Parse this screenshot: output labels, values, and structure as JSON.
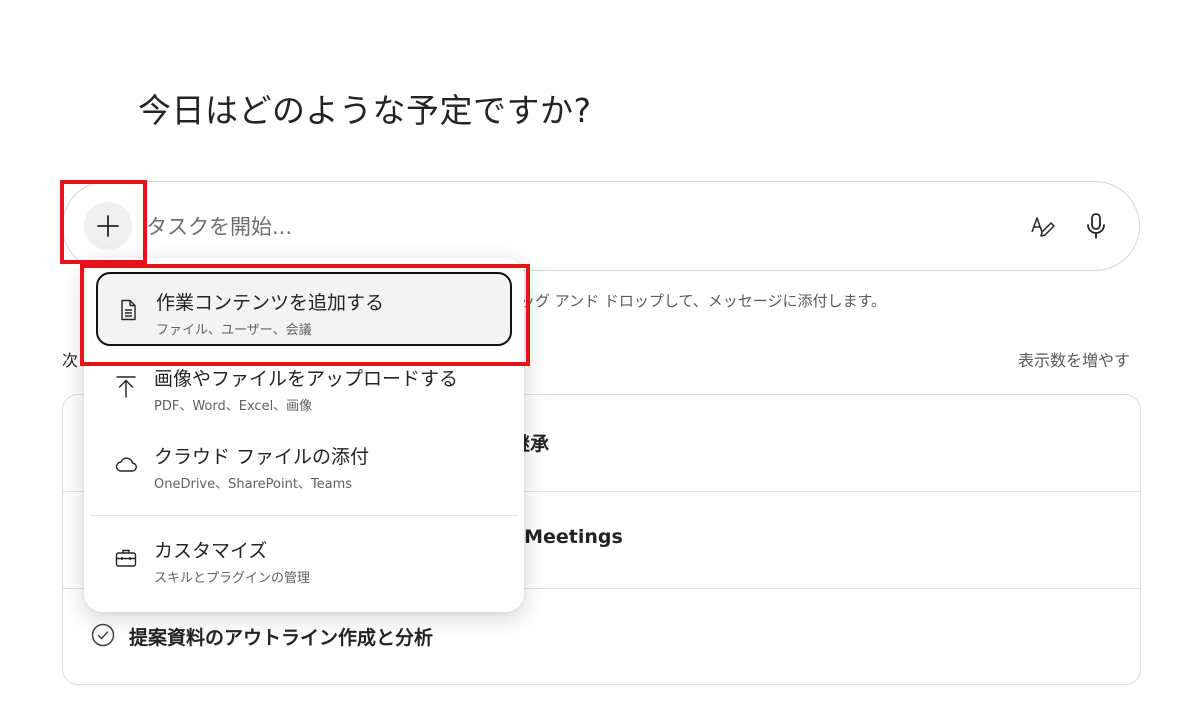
{
  "heading": "今日はどのような予定ですか?",
  "composer": {
    "placeholder": "タスクを開始...",
    "add_icon": "plus-icon",
    "rewrite_icon": "text-edit-pen-icon",
    "mic_icon": "microphone-icon"
  },
  "hint_text": "ッグ アンド ドロップして、メッセージに添付します。",
  "section": {
    "label": "次",
    "show_more": "表示数を増やす"
  },
  "tasks": [
    {
      "title": "継承"
    },
    {
      "title": "l Meetings"
    },
    {
      "title": "提案資料のアウトライン作成と分析",
      "icon": "check-circle-icon"
    }
  ],
  "menu": {
    "items": [
      {
        "label": "作業コンテンツを追加する",
        "sub": "ファイル、ユーザー、会議",
        "icon": "document-icon",
        "selected": true
      },
      {
        "label": "画像やファイルをアップロードする",
        "sub": "PDF、Word、Excel、画像",
        "icon": "upload-arrow-icon"
      },
      {
        "label": "クラウド ファイルの添付",
        "sub": "OneDrive、SharePoint、Teams",
        "icon": "cloud-icon"
      },
      {
        "label": "カスタマイズ",
        "sub": "スキルとプラグインの管理",
        "icon": "briefcase-icon"
      }
    ]
  },
  "colors": {
    "highlight": "#e3141b",
    "text": "#242424",
    "muted": "#616161"
  }
}
